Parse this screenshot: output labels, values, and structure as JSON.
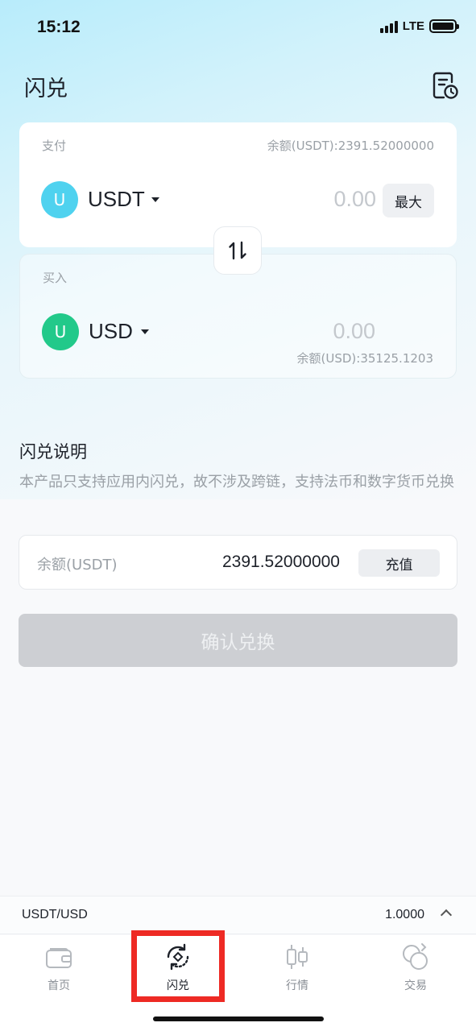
{
  "status_bar": {
    "time": "15:12",
    "network": "LTE"
  },
  "header": {
    "title": "闪兑",
    "history_icon": "history-document-icon"
  },
  "pay_card": {
    "label": "支付",
    "balance": "余额(USDT):2391.52000000",
    "coin_letter": "U",
    "coin": "USDT",
    "coin_color": "#4fd2ef",
    "amount_placeholder": "0.00",
    "max_label": "最大"
  },
  "buy_card": {
    "label": "买入",
    "coin_letter": "U",
    "coin": "USD",
    "coin_color": "#22c98a",
    "amount": "0.00",
    "balance": "余额(USD):35125.1203"
  },
  "description": {
    "title": "闪兑说明",
    "text": "本产品只支持应用内闪兑，故不涉及跨链，支持法币和数字货币兑换"
  },
  "balance_row": {
    "label": "余额(USDT)",
    "value": "2391.52000000",
    "deposit_label": "充值"
  },
  "confirm_button": {
    "label": "确认兑换"
  },
  "ticker": {
    "pair": "USDT/USD",
    "price": "1.0000"
  },
  "tabs": [
    {
      "label": "首页",
      "icon": "wallet-icon"
    },
    {
      "label": "闪兑",
      "icon": "flash-swap-icon",
      "active": true
    },
    {
      "label": "行情",
      "icon": "candlestick-icon"
    },
    {
      "label": "交易",
      "icon": "exchange-coins-icon"
    }
  ],
  "colors": {
    "highlight": "#ee2a24",
    "confirm_disabled": "#cdcfd3"
  }
}
